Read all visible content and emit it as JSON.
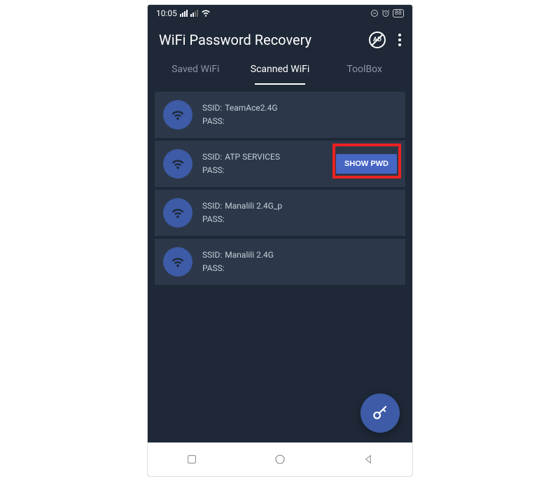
{
  "statusBar": {
    "time": "10:05",
    "battery": "88"
  },
  "header": {
    "title": "WiFi Password Recovery"
  },
  "tabs": {
    "items": [
      {
        "label": "Saved WiFi",
        "active": false
      },
      {
        "label": "Scanned WiFi",
        "active": true
      },
      {
        "label": "ToolBox",
        "active": false
      }
    ]
  },
  "labels": {
    "ssid": "SSID:",
    "pass": "PASS:",
    "showPwd": "SHOW PWD"
  },
  "networks": [
    {
      "ssid": "TeamAce2.4G",
      "pass": "",
      "showButton": false,
      "highlight": false
    },
    {
      "ssid": "ATP SERVICES",
      "pass": "",
      "showButton": true,
      "highlight": true
    },
    {
      "ssid": "Manalili 2.4G_p",
      "pass": "",
      "showButton": false,
      "highlight": false
    },
    {
      "ssid": "Manalili 2.4G",
      "pass": "",
      "showButton": false,
      "highlight": false
    }
  ]
}
